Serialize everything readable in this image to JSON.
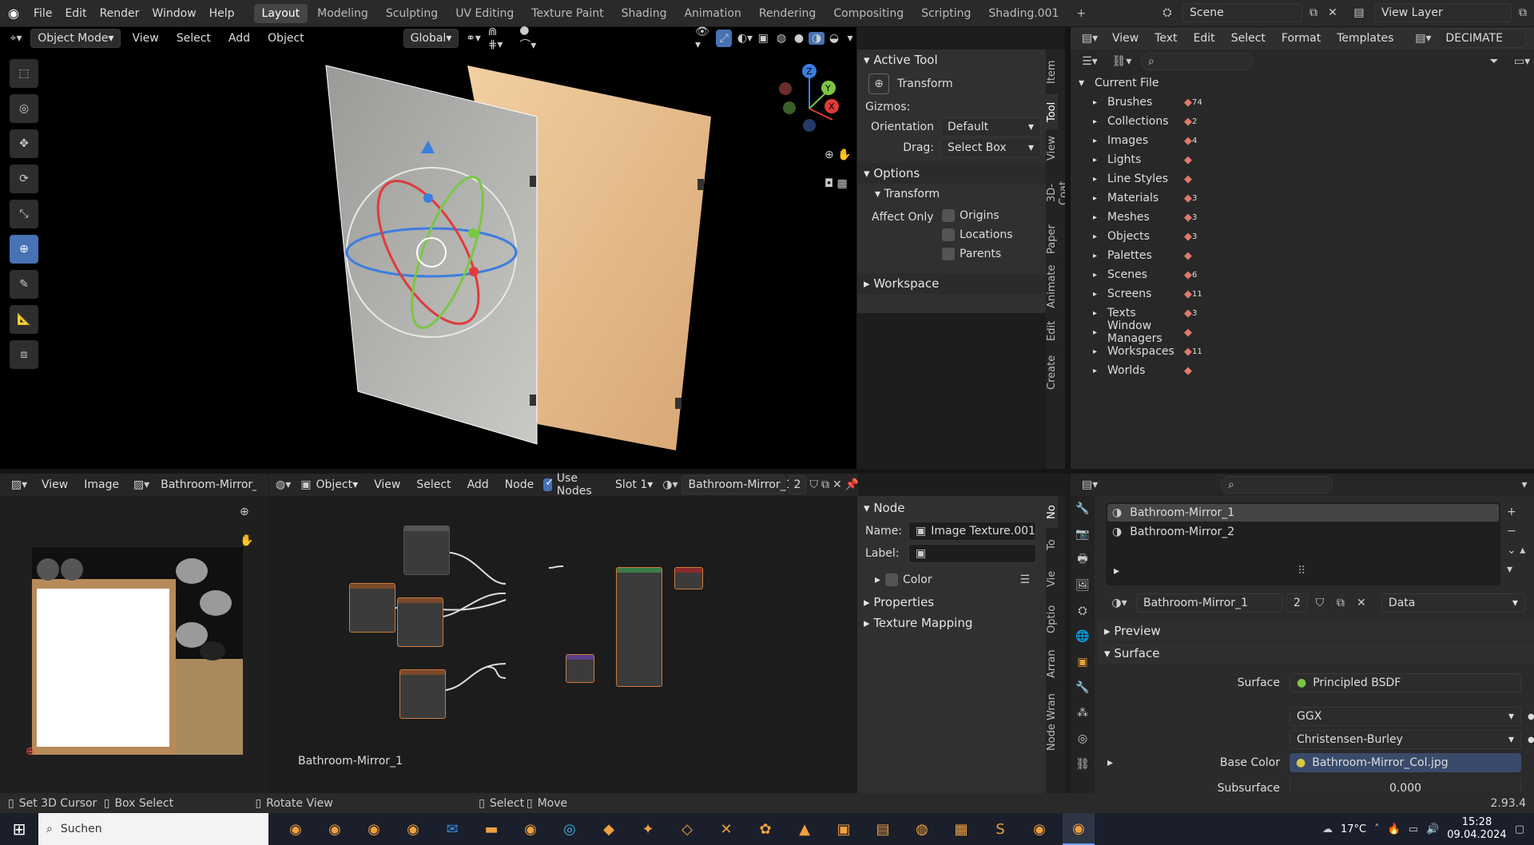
{
  "topbar": {
    "menus": [
      "File",
      "Edit",
      "Render",
      "Window",
      "Help"
    ],
    "workspace_tabs": [
      "Layout",
      "Modeling",
      "Sculpting",
      "UV Editing",
      "Texture Paint",
      "Shading",
      "Animation",
      "Rendering",
      "Compositing",
      "Scripting",
      "Shading.001"
    ],
    "active_tab": "Layout",
    "scene": "Scene",
    "view_layer": "View Layer"
  },
  "viewport": {
    "mode": "Object Mode",
    "menus": [
      "View",
      "Select",
      "Add",
      "Object"
    ],
    "orientation": "Global",
    "tools": [
      "select-box",
      "cursor",
      "move",
      "rotate",
      "scale",
      "transform",
      "annotate",
      "measure",
      "add-cube"
    ],
    "active_tool_index": 5
  },
  "tool_panel": {
    "active_tool_header": "Active Tool",
    "tool_name": "Transform",
    "gizmos_label": "Gizmos:",
    "orientation_label": "Orientation",
    "orientation_value": "Default",
    "drag_label": "Drag:",
    "drag_value": "Select Box",
    "options_header": "Options",
    "transform_header": "Transform",
    "affect_only_label": "Affect Only",
    "affect_options": [
      "Origins",
      "Locations",
      "Parents"
    ],
    "workspace_header": "Workspace",
    "side_tabs": [
      "Item",
      "Tool",
      "View",
      "3D-Coat",
      "Paper",
      "Animate",
      "Edit",
      "Create"
    ]
  },
  "text_editor_header": {
    "menus": [
      "View",
      "Text",
      "Edit",
      "Select",
      "Format",
      "Templates"
    ],
    "text_name": "DECIMATE"
  },
  "outliner": {
    "root": "Current File",
    "items": [
      {
        "label": "Brushes",
        "count": "74"
      },
      {
        "label": "Collections",
        "count": "2"
      },
      {
        "label": "Images",
        "count": "4"
      },
      {
        "label": "Lights",
        "count": ""
      },
      {
        "label": "Line Styles",
        "count": ""
      },
      {
        "label": "Materials",
        "count": "3"
      },
      {
        "label": "Meshes",
        "count": "3"
      },
      {
        "label": "Objects",
        "count": "3"
      },
      {
        "label": "Palettes",
        "count": ""
      },
      {
        "label": "Scenes",
        "count": "6"
      },
      {
        "label": "Screens",
        "count": "11"
      },
      {
        "label": "Texts",
        "count": "3"
      },
      {
        "label": "Window Managers",
        "count": ""
      },
      {
        "label": "Workspaces",
        "count": "11"
      },
      {
        "label": "Worlds",
        "count": ""
      }
    ]
  },
  "image_editor": {
    "menus": [
      "View",
      "Image"
    ],
    "image_name": "Bathroom-Mirror_"
  },
  "node_editor": {
    "object_label": "Object",
    "menus": [
      "View",
      "Select",
      "Add",
      "Node"
    ],
    "use_nodes": "Use Nodes",
    "slot": "Slot 1",
    "material": "Bathroom-Mirror_1",
    "users": "2",
    "footer_label": "Bathroom-Mirror_1",
    "node_panel": {
      "header": "Node",
      "name_label": "Name:",
      "name_value": "Image Texture.001",
      "label_label": "Label:",
      "label_value": "",
      "color": "Color",
      "properties": "Properties",
      "texture_mapping": "Texture Mapping"
    },
    "side_tabs": [
      "No",
      "To",
      "Vie",
      "Optio",
      "Arran",
      "Node Wran"
    ]
  },
  "properties": {
    "material_slots": [
      "Bathroom-Mirror_1",
      "Bathroom-Mirror_2"
    ],
    "material_name": "Bathroom-Mirror_1",
    "users": "2",
    "link": "Data",
    "preview": "Preview",
    "surface_header": "Surface",
    "surface_label": "Surface",
    "surface_value": "Principled BSDF",
    "distribution": "GGX",
    "subsurface_method": "Christensen-Burley",
    "base_color_label": "Base Color",
    "base_color_value": "Bathroom-Mirror_Col.jpg",
    "next_label": "Subsurface",
    "next_value": "0.000"
  },
  "status_bar": {
    "items": [
      "Set 3D Cursor",
      "Box Select",
      "Rotate View",
      "Select",
      "Move"
    ],
    "version": "2.93.4"
  },
  "taskbar": {
    "search": "Suchen",
    "temperature": "17°C",
    "time": "15:28",
    "date": "09.04.2024"
  }
}
